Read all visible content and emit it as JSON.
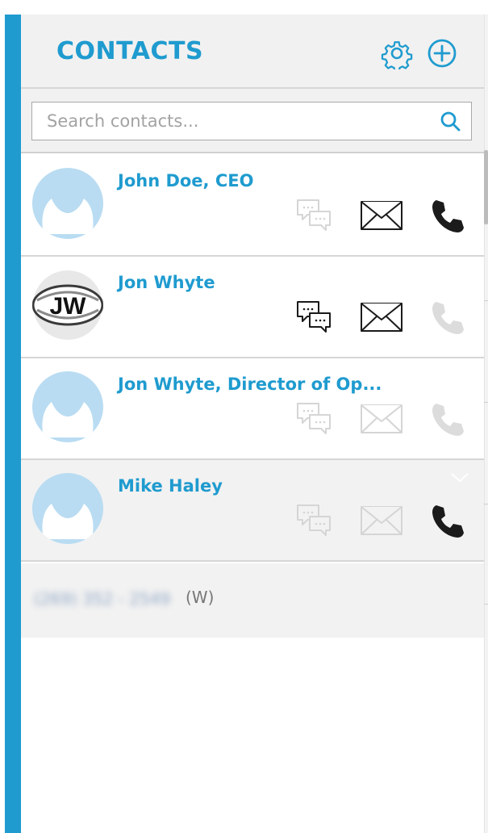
{
  "header": {
    "title": "CONTACTS",
    "icons": [
      "gear-icon",
      "add-circle-icon"
    ]
  },
  "search": {
    "placeholder": "Search contacts..."
  },
  "colors": {
    "accent": "#1f9bcf",
    "icon_active": "#1b1b1b",
    "icon_disabled": "#d5d5d5",
    "avatar_placeholder": "#b9dcf2"
  },
  "contacts": [
    {
      "name": "John Doe, CEO",
      "avatar": "person-silhouette",
      "chat_enabled": false,
      "email_enabled": true,
      "call_enabled": true
    },
    {
      "name": "Jon Whyte",
      "avatar": "JW",
      "chat_enabled": true,
      "email_enabled": true,
      "call_enabled": false
    },
    {
      "name": "Jon Whyte, Director of Op...",
      "avatar": "person-silhouette",
      "chat_enabled": false,
      "email_enabled": false,
      "call_enabled": false
    },
    {
      "name": "Mike Haley",
      "avatar": "person-silhouette",
      "chat_enabled": false,
      "email_enabled": false,
      "call_enabled": true,
      "selected": true
    }
  ],
  "expanded": {
    "phone": "(269) 352 - 2549",
    "phone_type": "(W)"
  }
}
